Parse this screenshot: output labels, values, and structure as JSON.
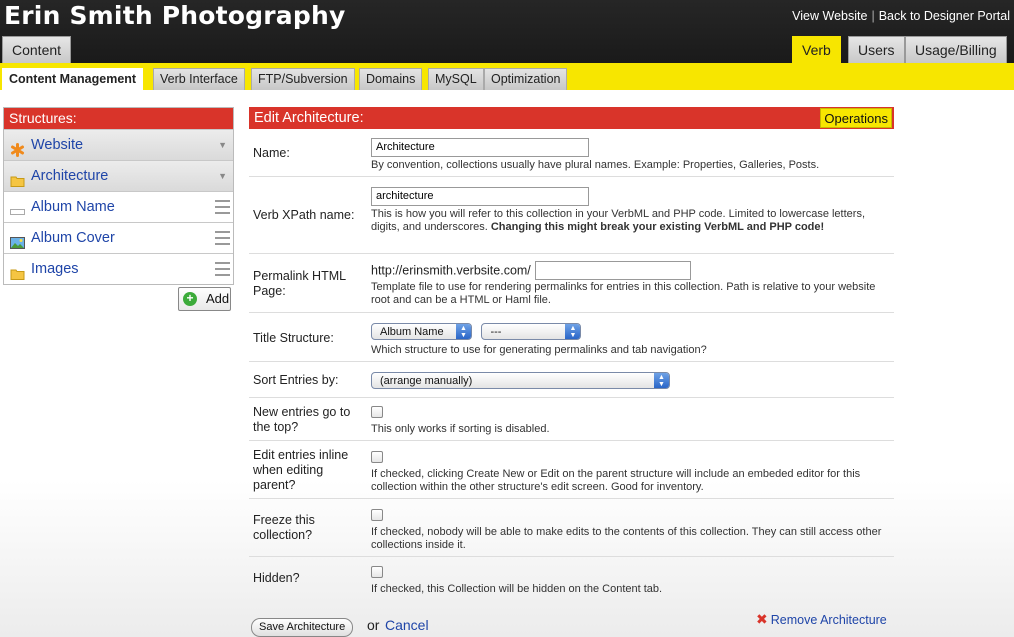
{
  "header": {
    "title": "Erin Smith Photography",
    "link_view": "View Website",
    "link_sep": "|",
    "link_back": "Back to Designer Portal"
  },
  "top_tabs": {
    "content": "Content",
    "verb": "Verb",
    "users": "Users",
    "usage": "Usage/Billing"
  },
  "sub_tabs": [
    "Content Management",
    "Verb Interface",
    "FTP/Subversion",
    "Domains",
    "MySQL",
    "Optimization"
  ],
  "sidebar": {
    "heading": "Structures:",
    "items": [
      {
        "label": "Website",
        "icon": "asterisk-icon"
      },
      {
        "label": "Architecture",
        "icon": "folder-icon"
      },
      {
        "label": "Album Name",
        "icon": "textfield-icon"
      },
      {
        "label": "Album Cover",
        "icon": "image-icon"
      },
      {
        "label": "Images",
        "icon": "folder-icon"
      }
    ],
    "add_label": "Add"
  },
  "panel": {
    "title": "Edit Architecture:",
    "operations": "Operations"
  },
  "form": {
    "name_label": "Name:",
    "name_value": "Architecture",
    "name_help": "By convention, collections usually have plural names. Example: Properties, Galleries, Posts.",
    "xpath_label": "Verb XPath name:",
    "xpath_value": "architecture",
    "xpath_help": "This is how you will refer to this collection in your VerbML and PHP code. Limited to lowercase letters, digits, and underscores.",
    "xpath_warning": "Changing this might break your existing VerbML and PHP code!",
    "permalink_label": "Permalink HTML Page:",
    "permalink_prefix": "http://erinsmith.verbsite.com/",
    "permalink_value": "",
    "permalink_help": "Template file to use for rendering permalinks for entries in this collection. Path is relative to your website root and can be a HTML or Haml file.",
    "title_label": "Title Structure:",
    "title_select1": "Album Name",
    "title_select2": "---",
    "title_help": "Which structure to use for generating permalinks and tab navigation?",
    "sort_label": "Sort Entries by:",
    "sort_value": "(arrange manually)",
    "newtop_label": "New entries go to the top?",
    "newtop_help": "This only works if sorting is disabled.",
    "inline_label": "Edit entries inline when editing parent?",
    "inline_help": "If checked, clicking Create New or Edit on the parent structure will include an embeded editor for this collection within the other structure's edit screen. Good for inventory.",
    "freeze_label": "Freeze this collection?",
    "freeze_help": "If checked, nobody will be able to make edits to the contents of this collection. They can still access other collections inside it.",
    "hidden_label": "Hidden?",
    "hidden_help": "If checked, this Collection will be hidden on the Content tab."
  },
  "footer": {
    "save": "Save Architecture",
    "or": "or",
    "cancel": "Cancel",
    "remove": "Remove Architecture"
  },
  "colors": {
    "header_bg": "#1f1f1f",
    "accent_yellow": "#f7e600",
    "accent_red": "#d9342a",
    "link_blue": "#1f45a8"
  }
}
